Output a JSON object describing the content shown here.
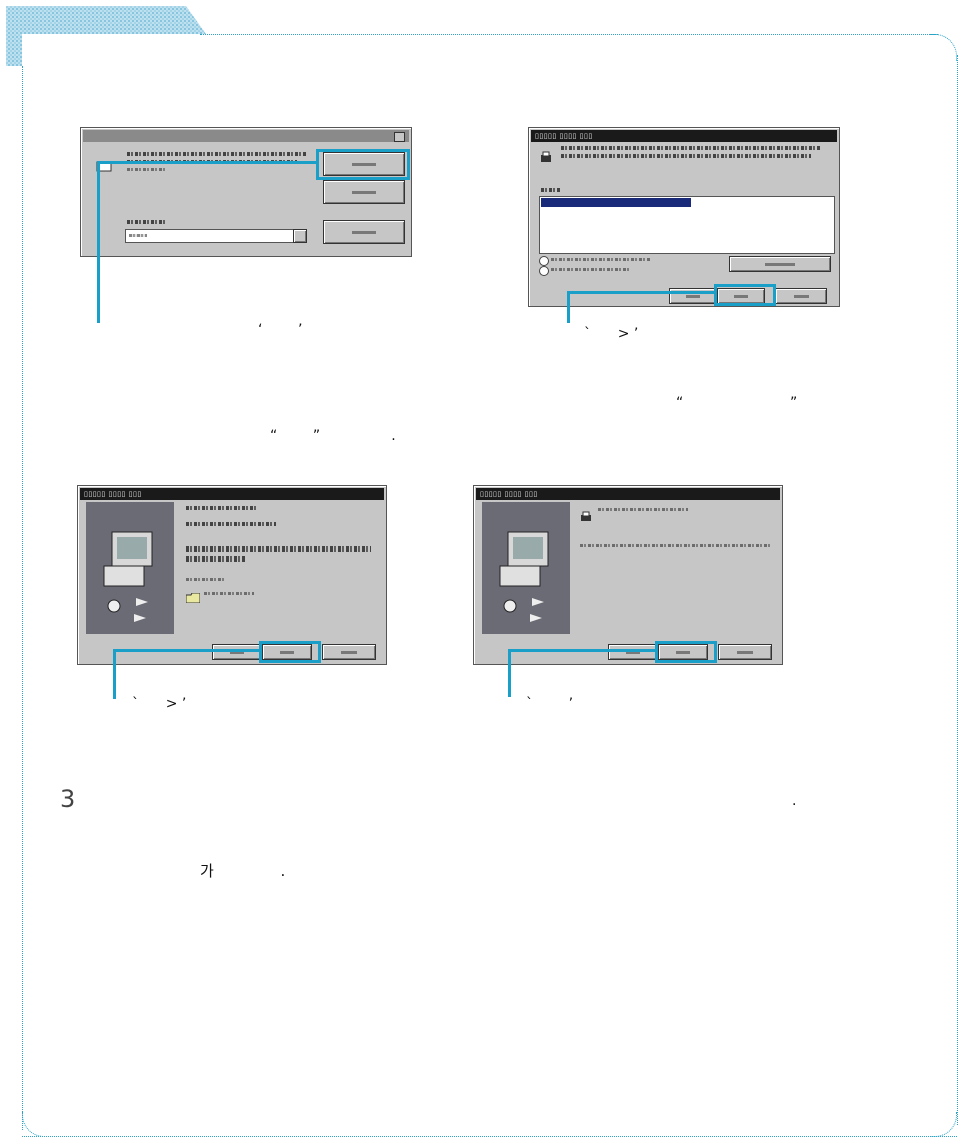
{
  "colors": {
    "accent": "#1a9fc8",
    "frame": "#2aa3c7",
    "dialog_bg": "#c6c6c6"
  },
  "captions": {
    "cap1": "‘        ’",
    "cap2": "`      > ’",
    "para_line1": "“                        ”",
    "para_line2": "“        ”                .",
    "cap3": "`      > ’",
    "cap4": "`        ’"
  },
  "step": {
    "number": "3",
    "dot": ".",
    "text": "가              ."
  },
  "icons": [
    "computer-icon",
    "printer-icon",
    "folder-icon",
    "dropdown-arrow-icon"
  ]
}
